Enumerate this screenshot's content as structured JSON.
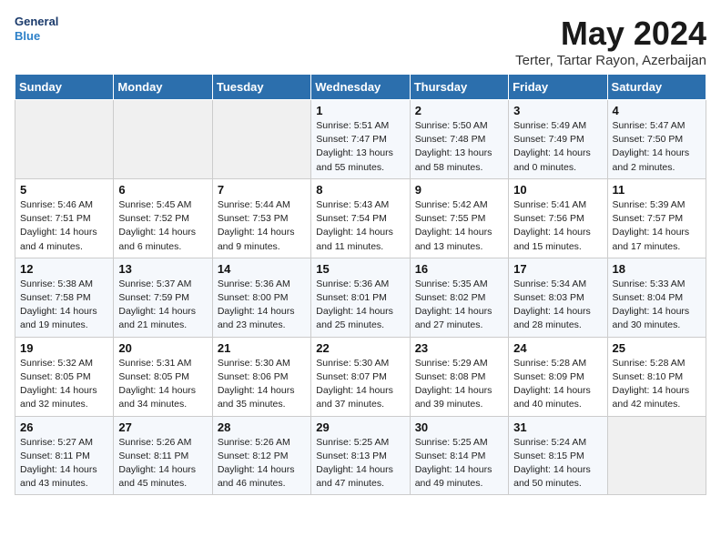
{
  "header": {
    "logo_line1": "General",
    "logo_line2": "Blue",
    "title": "May 2024",
    "subtitle": "Terter, Tartar Rayon, Azerbaijan"
  },
  "weekdays": [
    "Sunday",
    "Monday",
    "Tuesday",
    "Wednesday",
    "Thursday",
    "Friday",
    "Saturday"
  ],
  "weeks": [
    [
      {
        "day": "",
        "info": ""
      },
      {
        "day": "",
        "info": ""
      },
      {
        "day": "",
        "info": ""
      },
      {
        "day": "1",
        "info": "Sunrise: 5:51 AM\nSunset: 7:47 PM\nDaylight: 13 hours\nand 55 minutes."
      },
      {
        "day": "2",
        "info": "Sunrise: 5:50 AM\nSunset: 7:48 PM\nDaylight: 13 hours\nand 58 minutes."
      },
      {
        "day": "3",
        "info": "Sunrise: 5:49 AM\nSunset: 7:49 PM\nDaylight: 14 hours\nand 0 minutes."
      },
      {
        "day": "4",
        "info": "Sunrise: 5:47 AM\nSunset: 7:50 PM\nDaylight: 14 hours\nand 2 minutes."
      }
    ],
    [
      {
        "day": "5",
        "info": "Sunrise: 5:46 AM\nSunset: 7:51 PM\nDaylight: 14 hours\nand 4 minutes."
      },
      {
        "day": "6",
        "info": "Sunrise: 5:45 AM\nSunset: 7:52 PM\nDaylight: 14 hours\nand 6 minutes."
      },
      {
        "day": "7",
        "info": "Sunrise: 5:44 AM\nSunset: 7:53 PM\nDaylight: 14 hours\nand 9 minutes."
      },
      {
        "day": "8",
        "info": "Sunrise: 5:43 AM\nSunset: 7:54 PM\nDaylight: 14 hours\nand 11 minutes."
      },
      {
        "day": "9",
        "info": "Sunrise: 5:42 AM\nSunset: 7:55 PM\nDaylight: 14 hours\nand 13 minutes."
      },
      {
        "day": "10",
        "info": "Sunrise: 5:41 AM\nSunset: 7:56 PM\nDaylight: 14 hours\nand 15 minutes."
      },
      {
        "day": "11",
        "info": "Sunrise: 5:39 AM\nSunset: 7:57 PM\nDaylight: 14 hours\nand 17 minutes."
      }
    ],
    [
      {
        "day": "12",
        "info": "Sunrise: 5:38 AM\nSunset: 7:58 PM\nDaylight: 14 hours\nand 19 minutes."
      },
      {
        "day": "13",
        "info": "Sunrise: 5:37 AM\nSunset: 7:59 PM\nDaylight: 14 hours\nand 21 minutes."
      },
      {
        "day": "14",
        "info": "Sunrise: 5:36 AM\nSunset: 8:00 PM\nDaylight: 14 hours\nand 23 minutes."
      },
      {
        "day": "15",
        "info": "Sunrise: 5:36 AM\nSunset: 8:01 PM\nDaylight: 14 hours\nand 25 minutes."
      },
      {
        "day": "16",
        "info": "Sunrise: 5:35 AM\nSunset: 8:02 PM\nDaylight: 14 hours\nand 27 minutes."
      },
      {
        "day": "17",
        "info": "Sunrise: 5:34 AM\nSunset: 8:03 PM\nDaylight: 14 hours\nand 28 minutes."
      },
      {
        "day": "18",
        "info": "Sunrise: 5:33 AM\nSunset: 8:04 PM\nDaylight: 14 hours\nand 30 minutes."
      }
    ],
    [
      {
        "day": "19",
        "info": "Sunrise: 5:32 AM\nSunset: 8:05 PM\nDaylight: 14 hours\nand 32 minutes."
      },
      {
        "day": "20",
        "info": "Sunrise: 5:31 AM\nSunset: 8:05 PM\nDaylight: 14 hours\nand 34 minutes."
      },
      {
        "day": "21",
        "info": "Sunrise: 5:30 AM\nSunset: 8:06 PM\nDaylight: 14 hours\nand 35 minutes."
      },
      {
        "day": "22",
        "info": "Sunrise: 5:30 AM\nSunset: 8:07 PM\nDaylight: 14 hours\nand 37 minutes."
      },
      {
        "day": "23",
        "info": "Sunrise: 5:29 AM\nSunset: 8:08 PM\nDaylight: 14 hours\nand 39 minutes."
      },
      {
        "day": "24",
        "info": "Sunrise: 5:28 AM\nSunset: 8:09 PM\nDaylight: 14 hours\nand 40 minutes."
      },
      {
        "day": "25",
        "info": "Sunrise: 5:28 AM\nSunset: 8:10 PM\nDaylight: 14 hours\nand 42 minutes."
      }
    ],
    [
      {
        "day": "26",
        "info": "Sunrise: 5:27 AM\nSunset: 8:11 PM\nDaylight: 14 hours\nand 43 minutes."
      },
      {
        "day": "27",
        "info": "Sunrise: 5:26 AM\nSunset: 8:11 PM\nDaylight: 14 hours\nand 45 minutes."
      },
      {
        "day": "28",
        "info": "Sunrise: 5:26 AM\nSunset: 8:12 PM\nDaylight: 14 hours\nand 46 minutes."
      },
      {
        "day": "29",
        "info": "Sunrise: 5:25 AM\nSunset: 8:13 PM\nDaylight: 14 hours\nand 47 minutes."
      },
      {
        "day": "30",
        "info": "Sunrise: 5:25 AM\nSunset: 8:14 PM\nDaylight: 14 hours\nand 49 minutes."
      },
      {
        "day": "31",
        "info": "Sunrise: 5:24 AM\nSunset: 8:15 PM\nDaylight: 14 hours\nand 50 minutes."
      },
      {
        "day": "",
        "info": ""
      }
    ]
  ]
}
